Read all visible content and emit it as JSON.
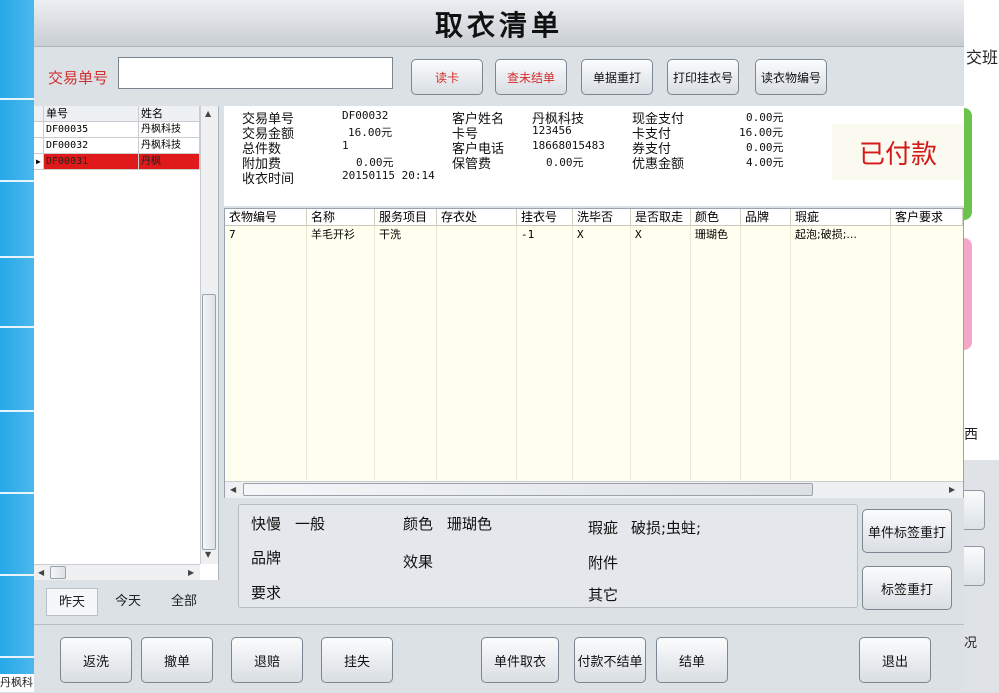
{
  "window": {
    "title": "取衣清单"
  },
  "toolbar": {
    "trade_no_label": "交易单号",
    "trade_no_value": "",
    "buttons": [
      "读卡",
      "查未结单",
      "单据重打",
      "打印挂衣号",
      "读衣物编号"
    ]
  },
  "order_list": {
    "headers": [
      "单号",
      "姓名"
    ],
    "rows": [
      {
        "no": "DF00035",
        "name": "丹枫科技"
      },
      {
        "no": "DF00032",
        "name": "丹枫科技"
      },
      {
        "no": "DF00031",
        "name": "丹枫"
      }
    ],
    "selected_index": 2
  },
  "day_tabs": {
    "items": [
      "昨天",
      "今天",
      "全部"
    ],
    "active": "昨天"
  },
  "order_info": {
    "trade_no_label": "交易单号",
    "trade_no": "DF00032",
    "amount_label": "交易金额",
    "amount": "16.00元",
    "count_label": "总件数",
    "count": "1",
    "extra_fee_label": "附加费",
    "extra_fee": "0.00元",
    "receive_time_label": "收衣时间",
    "receive_time": "20150115 20:14",
    "customer_name_label": "客户姓名",
    "customer_name": "丹枫科技",
    "card_no_label": "卡号",
    "card_no": "123456",
    "phone_label": "客户电话",
    "phone": "18668015483",
    "storage_fee_label": "保管费",
    "storage_fee": "0.00元",
    "cash_label": "现金支付",
    "cash": "0.00元",
    "card_pay_label": "卡支付",
    "card_pay": "16.00元",
    "coupon_label": "券支付",
    "coupon": "0.00元",
    "discount_label": "优惠金额",
    "discount": "4.00元",
    "status": "已付款"
  },
  "items_table": {
    "headers": [
      "衣物编号",
      "名称",
      "服务项目",
      "存衣处",
      "挂衣号",
      "洗毕否",
      "是否取走",
      "颜色",
      "品牌",
      "瑕疵",
      "客户要求"
    ],
    "rows": [
      [
        "7",
        "羊毛开衫",
        "干洗",
        "",
        "-1",
        "X",
        "X",
        "珊瑚色",
        "",
        "起泡;破损;...",
        ""
      ]
    ]
  },
  "details": {
    "speed_label": "快慢",
    "speed_value": "一般",
    "color_label": "颜色",
    "color_value": "珊瑚色",
    "defect_label": "瑕疵",
    "defect_value": "破损;虫蛀;",
    "brand_label": "品牌",
    "effect_label": "效果",
    "accessory_label": "附件",
    "requirement_label": "要求",
    "other_label": "其它"
  },
  "side_buttons": [
    "单件标签重打",
    "标签重打"
  ],
  "bottom_buttons": [
    "返洗",
    "撤单",
    "退赔",
    "挂失",
    "单件取衣",
    "付款不结单",
    "结单",
    "退出"
  ],
  "background": {
    "right_texts": [
      "交班",
      "西",
      "况"
    ],
    "left_status": "丹枫科"
  },
  "colors": {
    "accent_red": "#d32d2d",
    "selected_row": "#e01a1a",
    "paid_red": "#d51a1a"
  }
}
